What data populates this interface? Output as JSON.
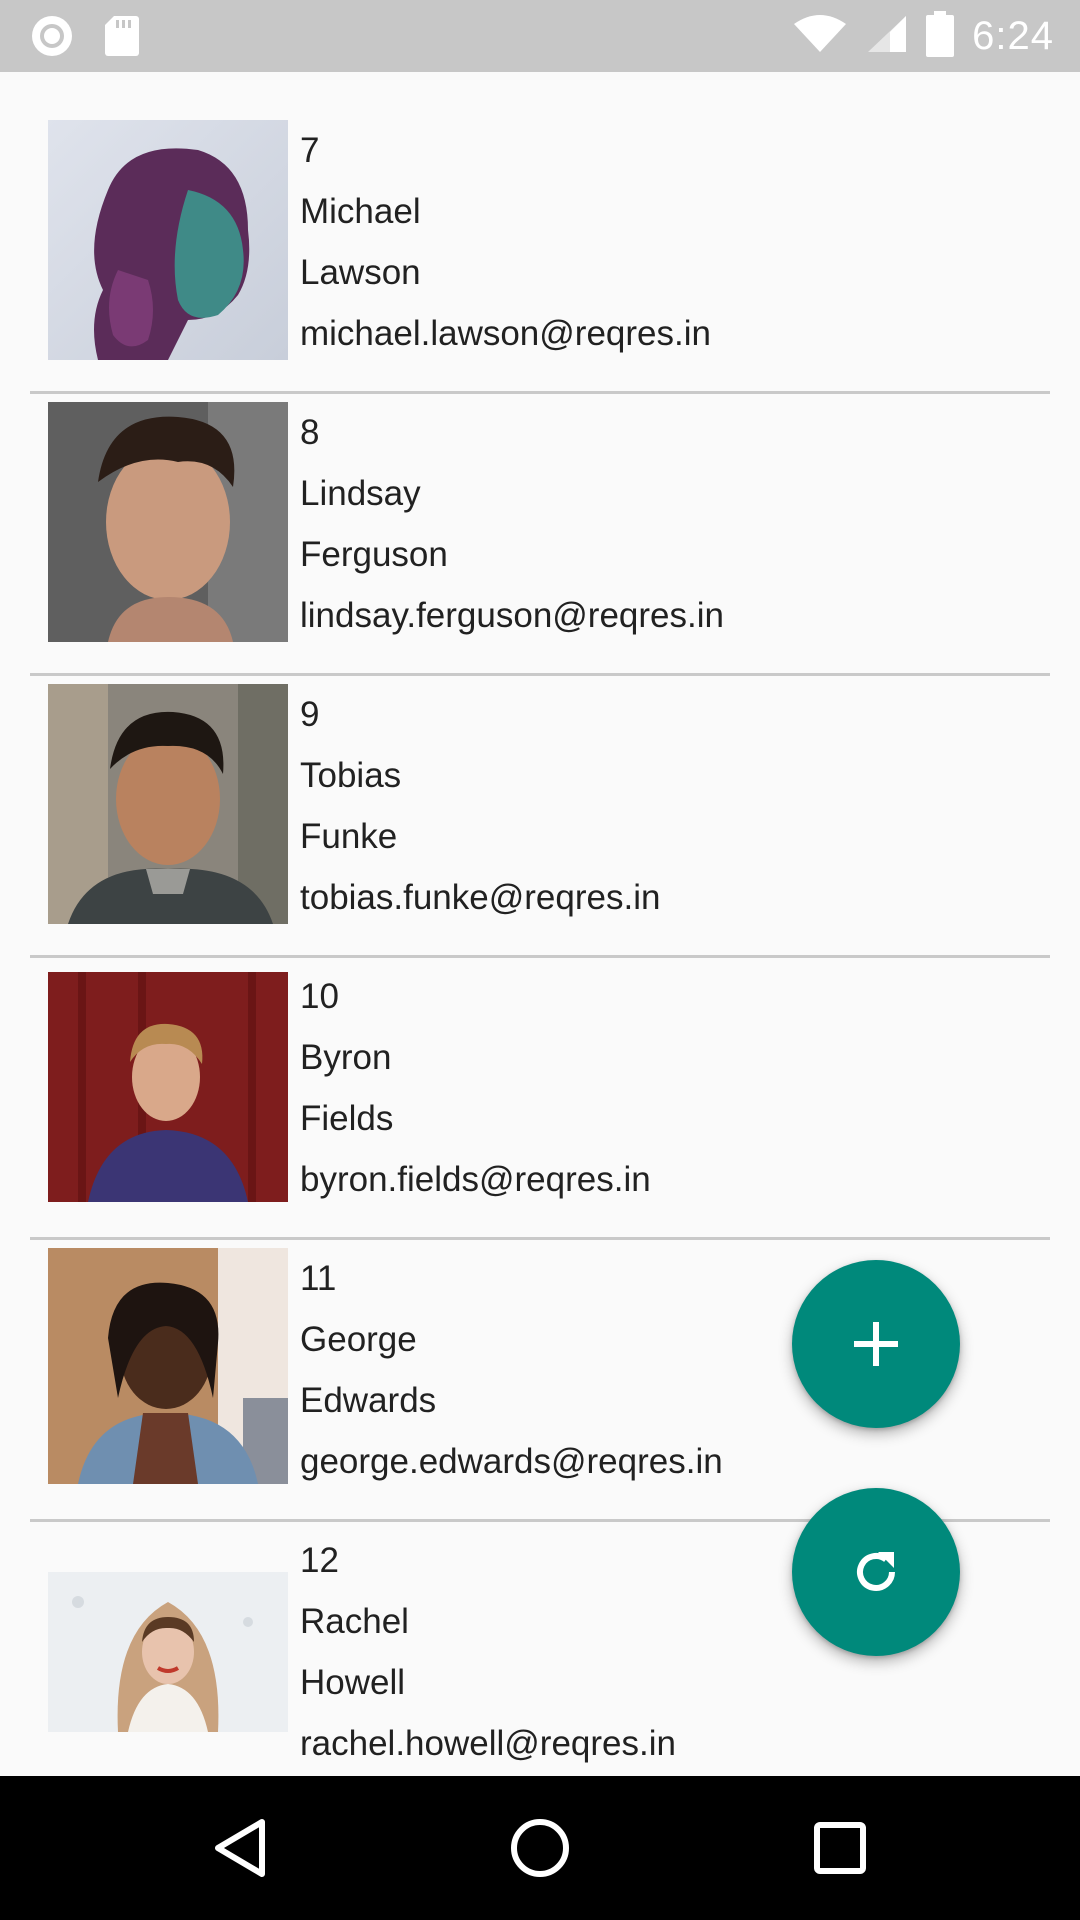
{
  "status_bar": {
    "time": "6:24",
    "left_icons": [
      "record-icon",
      "sd-card-icon"
    ],
    "right_icons": [
      "wifi-icon",
      "signal-icon",
      "battery-icon"
    ]
  },
  "users": [
    {
      "id": "7",
      "first_name": "Michael",
      "last_name": "Lawson",
      "email": "michael.lawson@reqres.in"
    },
    {
      "id": "8",
      "first_name": "Lindsay",
      "last_name": "Ferguson",
      "email": "lindsay.ferguson@reqres.in"
    },
    {
      "id": "9",
      "first_name": "Tobias",
      "last_name": "Funke",
      "email": "tobias.funke@reqres.in"
    },
    {
      "id": "10",
      "first_name": "Byron",
      "last_name": "Fields",
      "email": "byron.fields@reqres.in"
    },
    {
      "id": "11",
      "first_name": "George",
      "last_name": "Edwards",
      "email": "george.edwards@reqres.in"
    },
    {
      "id": "12",
      "first_name": "Rachel",
      "last_name": "Howell",
      "email": "rachel.howell@reqres.in"
    }
  ],
  "fabs": {
    "add_icon": "plus-icon",
    "refresh_icon": "refresh-icon"
  },
  "nav": {
    "icons": [
      "back-triangle-icon",
      "home-circle-icon",
      "recents-square-icon"
    ]
  },
  "colors": {
    "accent": "#00897b",
    "status_bar": "#c7c7c7",
    "nav_bar": "#000000",
    "background": "#fafafa",
    "divider": "#c9c9c9"
  }
}
